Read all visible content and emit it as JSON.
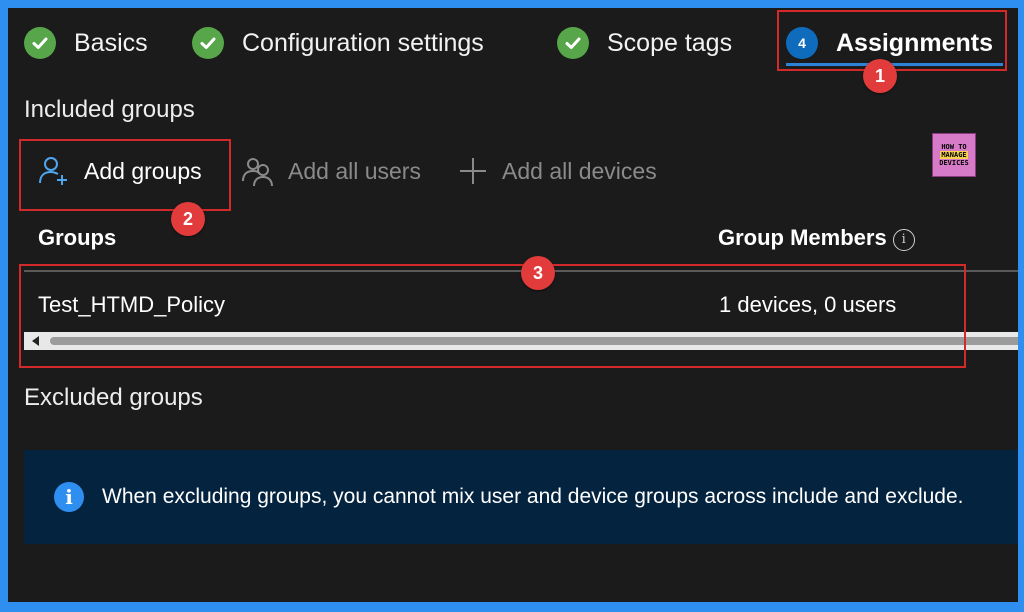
{
  "tabs": [
    {
      "label": "Basics",
      "state": "complete"
    },
    {
      "label": "Configuration settings",
      "state": "complete"
    },
    {
      "label": "Scope tags",
      "state": "complete"
    },
    {
      "label": "Assignments",
      "number": "4",
      "state": "active"
    }
  ],
  "included": {
    "title": "Included groups",
    "toolbar": {
      "add_groups": "Add groups",
      "add_all_users": "Add all users",
      "add_all_devices": "Add all devices"
    },
    "columns": {
      "groups": "Groups",
      "members": "Group Members",
      "members_info_glyph": "i"
    },
    "rows": [
      {
        "group": "Test_HTMD_Policy",
        "members": "1 devices, 0 users"
      }
    ]
  },
  "excluded": {
    "title": "Excluded groups",
    "info_glyph": "i",
    "info_text": "When excluding groups, you cannot mix user and device groups across include and exclude."
  },
  "callouts": [
    "1",
    "2",
    "3"
  ],
  "logo": {
    "line1": "HOW TO",
    "line2": "MANAGE",
    "line3": "DEVICES"
  },
  "colors": {
    "background": "#1b1b1b",
    "accent": "#2c83d8",
    "complete": "#57a64a",
    "callout": "#d22a2a",
    "info_banner": "#04233f",
    "page_border": "#2f8ff0"
  }
}
